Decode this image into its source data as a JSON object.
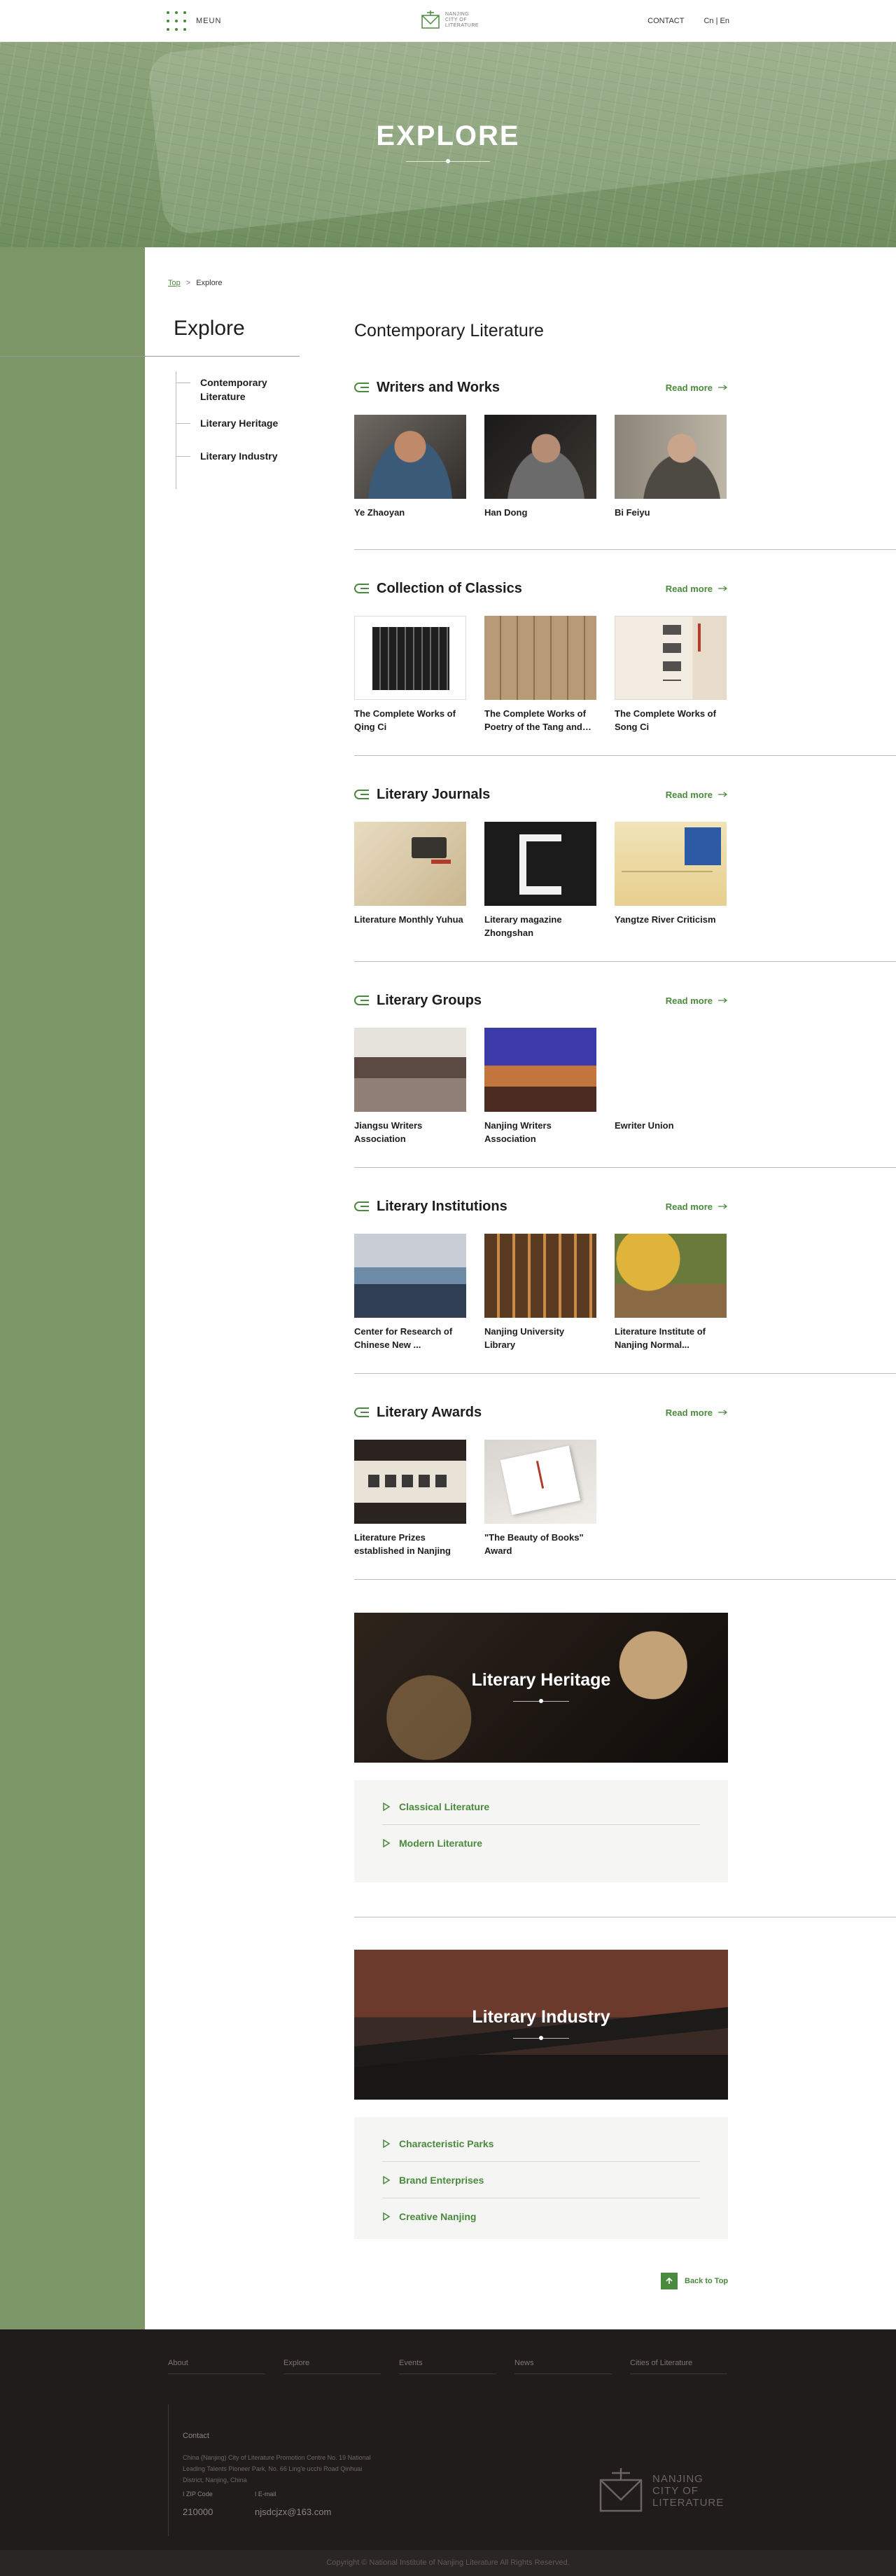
{
  "header": {
    "menu_label": "MEUN",
    "logo_text": "NANJING CITY OF LITERATURE",
    "contact": "CONTACT",
    "lang_cn": "Cn",
    "lang_sep": "|",
    "lang_en": "En"
  },
  "hero": {
    "title": "EXPLORE"
  },
  "breadcrumb": {
    "top": "Top",
    "sep": ">",
    "current": "Explore"
  },
  "sidebar": {
    "heading": "Explore",
    "items": [
      {
        "label": "Contemporary Literature"
      },
      {
        "label": "Literary Heritage"
      },
      {
        "label": "Literary Industry"
      }
    ]
  },
  "main": {
    "title": "Contemporary Literature",
    "read_more": "Read more",
    "sections": [
      {
        "title": "Writers and Works",
        "cards": [
          "Ye Zhaoyan",
          "Han Dong",
          "Bi Feiyu"
        ]
      },
      {
        "title": "Collection of Classics",
        "cards": [
          "The Complete Works of Qing Ci",
          "The Complete Works of Poetry of the Tang and…",
          "The Complete Works of Song Ci"
        ]
      },
      {
        "title": "Literary Journals",
        "cards": [
          "Literature Monthly Yuhua",
          "Literary magazine Zhongshan",
          "Yangtze River Criticism"
        ]
      },
      {
        "title": "Literary Groups",
        "cards": [
          "Jiangsu Writers Association",
          "Nanjing Writers Association",
          "Ewriter Union"
        ]
      },
      {
        "title": "Literary Institutions",
        "cards": [
          "Center for Research of Chinese New ...",
          "Nanjing University Library",
          "Literature Institute of Nanjing Normal..."
        ]
      },
      {
        "title": "Literary Awards",
        "cards": [
          "Literature Prizes established in Nanjing",
          "\"The Beauty of Books\" Award"
        ]
      }
    ]
  },
  "heritage": {
    "title": "Literary Heritage",
    "links": [
      "Classical Literature",
      "Modern Literature"
    ]
  },
  "industry": {
    "title": "Literary Industry",
    "links": [
      "Characteristic Parks",
      "Brand Enterprises",
      "Creative Nanjing"
    ]
  },
  "back_to_top": "Back to Top",
  "footer": {
    "nav": [
      "About",
      "Explore",
      "Events",
      "News",
      "Cities of Literature"
    ],
    "contact_label": "Contact",
    "address": "China (Nanjing) City of Literature Promotion Centre No. 19 National Leading Talents Pioneer Park, No. 66 Ling'e ucchi Road Qinhuai District, Nanjing, China",
    "zip_label": "ZIP Code",
    "zip": "210000",
    "email_label": "E-mail",
    "email": "njsdcjzx@163.com",
    "logo_text": "NANJING CITY OF LITERATURE",
    "copyright": "Copyright © National Institute of Nanjing Literature All Rights Reserved."
  },
  "colors": {
    "accent": "#4a8a3d",
    "side_green": "#7c9667",
    "footer_bg": "#201c1c"
  }
}
